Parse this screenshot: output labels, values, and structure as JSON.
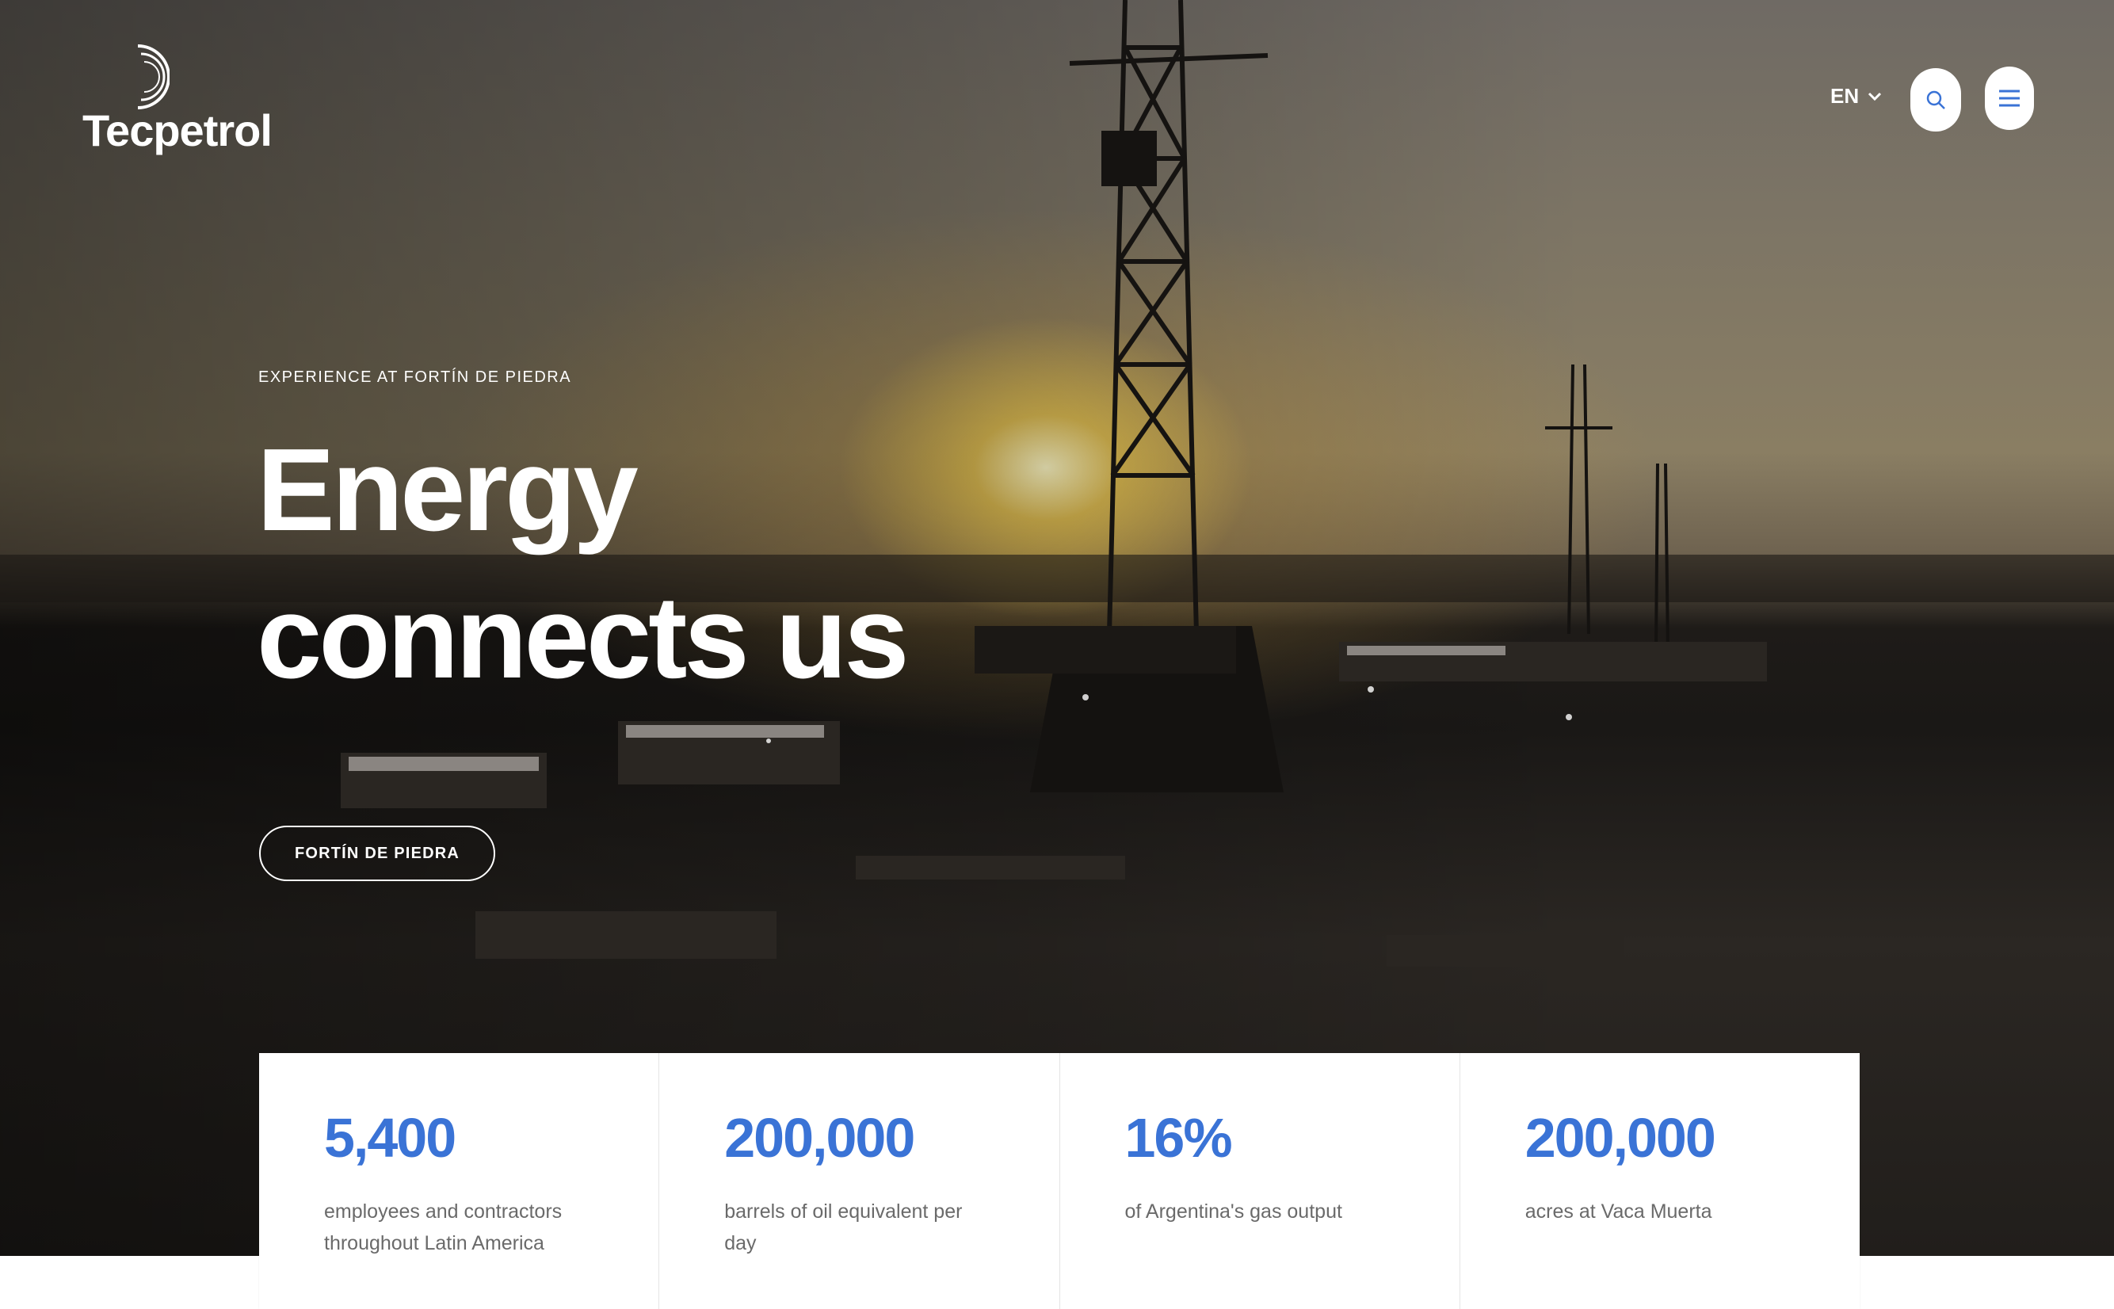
{
  "brand": {
    "name": "Tecpetrol"
  },
  "header": {
    "language": "EN",
    "icons": {
      "language": "chevron-down-icon",
      "search": "search-icon",
      "menu": "hamburger-menu-icon"
    }
  },
  "hero": {
    "eyebrow": "EXPERIENCE AT FORTÍN DE PIEDRA",
    "headline_line1": "Energy",
    "headline_line2": "connects us",
    "cta_label": "FORTÍN DE PIEDRA"
  },
  "stats": [
    {
      "value": "5,400",
      "label": "employees and contractors throughout Latin America"
    },
    {
      "value": "200,000",
      "label": "barrels of oil equivalent per day"
    },
    {
      "value": "16%",
      "label": "of Argentina's gas output"
    },
    {
      "value": "200,000",
      "label": "acres at Vaca Muerta"
    }
  ],
  "colors": {
    "accent": "#3a73d6",
    "text_light": "#ffffff",
    "stat_label": "#6a6a6a"
  }
}
